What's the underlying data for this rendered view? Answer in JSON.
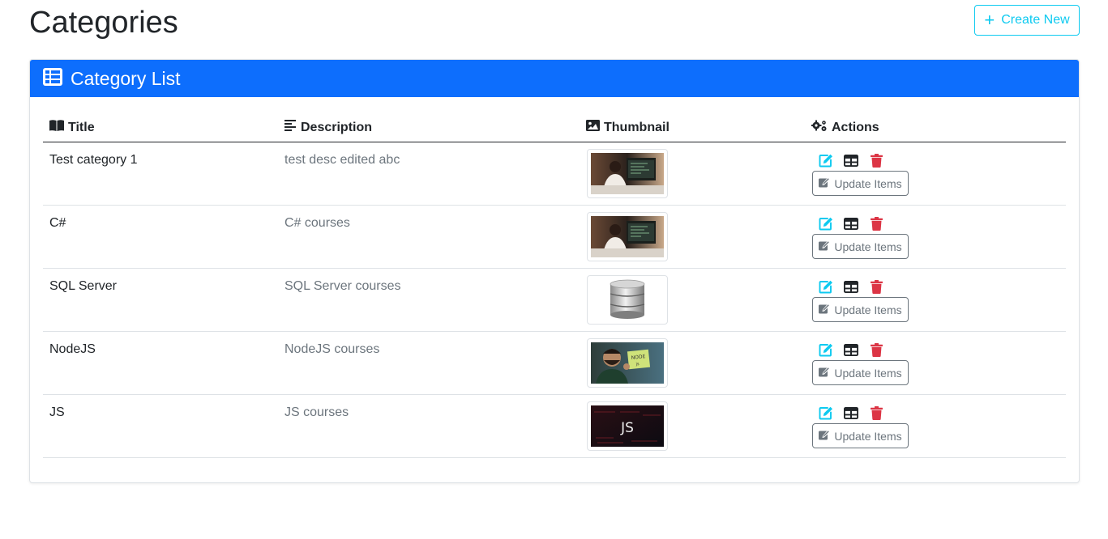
{
  "header": {
    "title": "Categories",
    "create_label": "Create New"
  },
  "card": {
    "title": "Category List"
  },
  "table": {
    "columns": {
      "title": "Title",
      "description": "Description",
      "thumbnail": "Thumbnail",
      "actions": "Actions"
    },
    "rows": [
      {
        "title": "Test category 1",
        "description": "test desc edited abc",
        "thumbnail": "person-at-computer",
        "update_label": "Update Items"
      },
      {
        "title": "C#",
        "description": "C# courses",
        "thumbnail": "person-at-computer",
        "update_label": "Update Items"
      },
      {
        "title": "SQL Server",
        "description": "SQL Server courses",
        "thumbnail": "database-cylinder",
        "update_label": "Update Items"
      },
      {
        "title": "NodeJS",
        "description": "NodeJS courses",
        "thumbnail": "person-holding-node-note",
        "update_label": "Update Items"
      },
      {
        "title": "JS",
        "description": "JS courses",
        "thumbnail": "js-code-banner",
        "thumbnail_text": "JS",
        "update_label": "Update Items"
      }
    ]
  },
  "icons": {
    "edit": "edit-icon",
    "details": "table-icon",
    "delete": "trash-icon"
  },
  "colors": {
    "primary": "#0d6efd",
    "info": "#0dcaf0",
    "danger": "#dc3545",
    "secondary": "#6c757d"
  }
}
